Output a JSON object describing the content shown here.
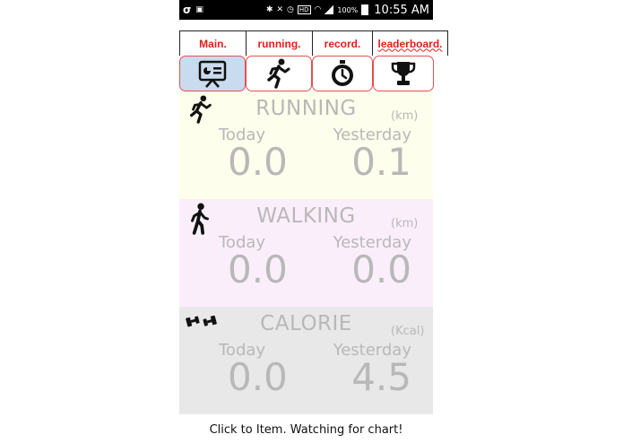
{
  "status_bar": {
    "battery": "100%",
    "time": "10:55 AM",
    "hd_badge": "HD"
  },
  "tabs": [
    {
      "label": "Main."
    },
    {
      "label": "running."
    },
    {
      "label": "record."
    },
    {
      "label": "leaderboard."
    }
  ],
  "icon_buttons": [
    {
      "icon": "presentation-chart-icon",
      "active": true
    },
    {
      "icon": "running-man-icon",
      "active": false
    },
    {
      "icon": "stopwatch-icon",
      "active": false
    },
    {
      "icon": "trophy-icon",
      "active": false
    }
  ],
  "panels": {
    "running": {
      "title": "RUNNING",
      "unit": "(km)",
      "today_label": "Today",
      "yesterday_label": "Yesterday",
      "today_value": "0.0",
      "yesterday_value": "0.1",
      "bg": "#fdfeeb"
    },
    "walking": {
      "title": "WALKING",
      "unit": "(km)",
      "today_label": "Today",
      "yesterday_label": "Yesterday",
      "today_value": "0.0",
      "yesterday_value": "0.0",
      "bg": "#fbeefb"
    },
    "calorie": {
      "title": "CALORIE",
      "unit": "(Kcal)",
      "today_label": "Today",
      "yesterday_label": "Yesterday",
      "today_value": "0.0",
      "yesterday_value": "4.5",
      "bg": "#e8e8e8"
    }
  },
  "footer": "Click to Item. Watching for chart!",
  "colors": {
    "tab_text": "#e0201c",
    "button_border": "#e45050",
    "active_button": "#c9dbef",
    "value_gray": "#b8b8b8"
  }
}
